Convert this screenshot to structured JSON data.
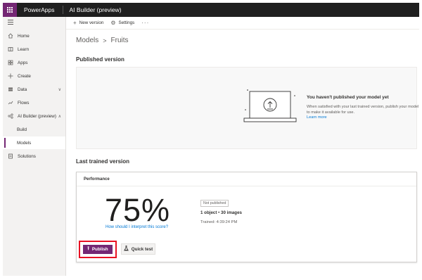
{
  "topbar": {
    "app_title": "PowerApps",
    "section_title": "AI Builder (preview)"
  },
  "sidebar": {
    "items": [
      {
        "label": "Home",
        "icon": "home-icon"
      },
      {
        "label": "Learn",
        "icon": "book-icon"
      },
      {
        "label": "Apps",
        "icon": "apps-icon"
      },
      {
        "label": "Create",
        "icon": "plus-icon"
      },
      {
        "label": "Data",
        "icon": "table-icon",
        "chevron": "∨"
      },
      {
        "label": "Flows",
        "icon": "flow-icon"
      },
      {
        "label": "AI Builder (preview)",
        "icon": "ai-builder-icon",
        "chevron": "∧"
      },
      {
        "label": "Build"
      },
      {
        "label": "Models",
        "active": true
      },
      {
        "label": "Solutions",
        "icon": "solutions-icon"
      }
    ]
  },
  "toolbar": {
    "new_version": "New version",
    "settings": "Settings",
    "more": "···"
  },
  "breadcrumb": {
    "parent": "Models",
    "current": "Fruits"
  },
  "published": {
    "heading": "Published version",
    "title": "You haven't published your model yet",
    "body": "When satisfied with your last trained version, publish your model to make it available for use.",
    "link": "Learn more"
  },
  "trained": {
    "heading": "Last trained version",
    "card_title": "Performance",
    "score": "75%",
    "score_link": "How should I interpret this score?",
    "status": "Not published",
    "objects": "1 object",
    "bullet": "•",
    "images": "30 images",
    "trained_label": "Trained: 4:39:24 PM",
    "publish_label": "Publish",
    "quicktest_label": "Quick test"
  },
  "colors": {
    "brand": "#742774",
    "link": "#0078d4",
    "highlight": "#e81123"
  }
}
